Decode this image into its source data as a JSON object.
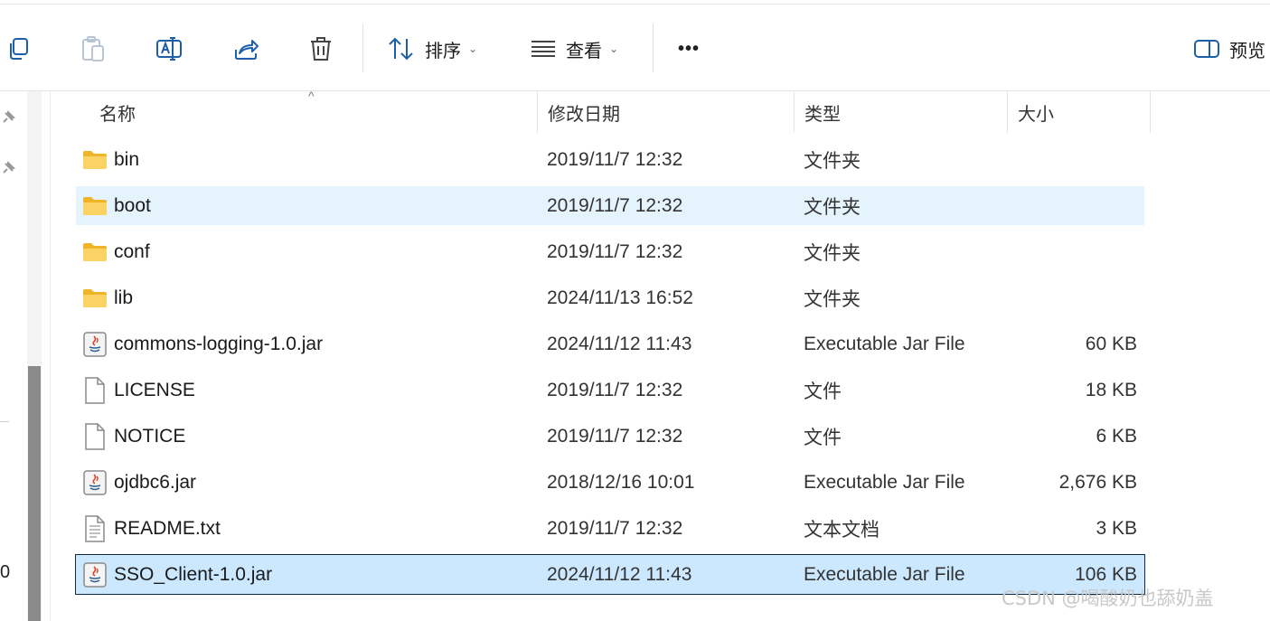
{
  "toolbar": {
    "sort_label": "排序",
    "view_label": "查看",
    "more_label": "•••",
    "preview_label": "预览"
  },
  "columns": {
    "name": "名称",
    "date": "修改日期",
    "type": "类型",
    "size": "大小"
  },
  "files": [
    {
      "icon": "folder-icon",
      "name": "bin",
      "date": "2019/11/7 12:32",
      "type": "文件夹",
      "size": ""
    },
    {
      "icon": "folder-icon",
      "name": "boot",
      "date": "2019/11/7 12:32",
      "type": "文件夹",
      "size": "",
      "state": "hover"
    },
    {
      "icon": "folder-icon",
      "name": "conf",
      "date": "2019/11/7 12:32",
      "type": "文件夹",
      "size": ""
    },
    {
      "icon": "folder-icon",
      "name": "lib",
      "date": "2024/11/13 16:52",
      "type": "文件夹",
      "size": ""
    },
    {
      "icon": "java-jar-icon",
      "name": "commons-logging-1.0.jar",
      "date": "2024/11/12 11:43",
      "type": "Executable Jar File",
      "size": "60 KB"
    },
    {
      "icon": "blank-file-icon",
      "name": "LICENSE",
      "date": "2019/11/7 12:32",
      "type": "文件",
      "size": "18 KB"
    },
    {
      "icon": "blank-file-icon",
      "name": "NOTICE",
      "date": "2019/11/7 12:32",
      "type": "文件",
      "size": "6 KB"
    },
    {
      "icon": "java-jar-icon",
      "name": "ojdbc6.jar",
      "date": "2018/12/16 10:01",
      "type": "Executable Jar File",
      "size": "2,676 KB"
    },
    {
      "icon": "text-file-icon",
      "name": "README.txt",
      "date": "2019/11/7 12:32",
      "type": "文本文档",
      "size": "3 KB"
    },
    {
      "icon": "java-jar-icon",
      "name": "SSO_Client-1.0.jar",
      "date": "2024/11/12 11:43",
      "type": "Executable Jar File",
      "size": "106 KB",
      "state": "selected"
    }
  ],
  "nav": {
    "glyph": "0"
  },
  "watermark": "CSDN @喝酸奶也舔奶盖",
  "colors": {
    "hover_row": "#e5f3fd",
    "selected_row": "#cce8ff",
    "accent_icon": "#1e5fa8",
    "folder": "#f6c744"
  }
}
